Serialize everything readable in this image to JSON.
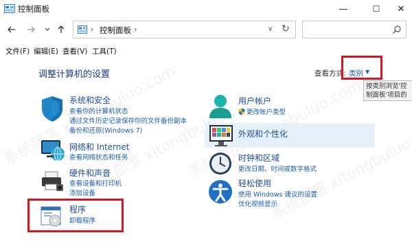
{
  "window": {
    "title": "控制面板",
    "minimize": "—",
    "maximize": "☐",
    "close": "✕"
  },
  "address": {
    "crumb": "控制面板"
  },
  "menu": [
    "文件(F)",
    "编辑(E)",
    "查看(V)",
    "工具(T)"
  ],
  "main": {
    "heading": "调整计算机的设置",
    "view_by_label": "查看方式:",
    "view_by_value": "类别",
    "tooltip": "按类别浏览'控制面板'项目的完整列表。"
  },
  "categories": {
    "system": {
      "title": "系统和安全",
      "links": [
        "查看你的计算机状态",
        "通过文件历史记录保存你的文件备份副本",
        "备份和还原(Windows 7)"
      ]
    },
    "network": {
      "title": "网络和 Internet",
      "links": [
        "查看网络状态和任务"
      ]
    },
    "hardware": {
      "title": "硬件和声音",
      "links": [
        "查看设备和打印机",
        "添加设备"
      ]
    },
    "programs": {
      "title": "程序",
      "links": [
        "卸载程序"
      ]
    },
    "users": {
      "title": "用户帐户",
      "links": [
        "更改帐户类型"
      ]
    },
    "appearance": {
      "title": "外观和个性化",
      "links": []
    },
    "clock": {
      "title": "时钟和区域",
      "links": [
        "更改日期、时间或数字格式"
      ]
    },
    "ease": {
      "title": "轻松使用",
      "links": [
        "使用 Windows 建议的设置",
        "优化视频显示"
      ]
    }
  },
  "watermark": [
    "系统部落 xitongbuluo.com"
  ],
  "colors": {
    "accent_link": "#1a5fb4",
    "heading": "#1e3a8a",
    "annotation_red": "#d9141f",
    "hover_bg": "#e5f1fb"
  }
}
